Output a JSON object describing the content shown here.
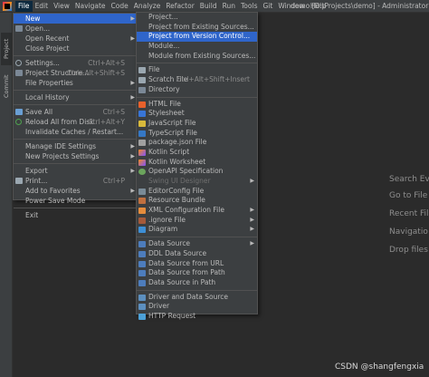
{
  "menubar": {
    "items": [
      "File",
      "Edit",
      "View",
      "Navigate",
      "Code",
      "Analyze",
      "Refactor",
      "Build",
      "Run",
      "Tools",
      "Git",
      "Window",
      "Help"
    ],
    "window_title": "demo [D:\\Projects\\demo] - Administrator"
  },
  "left_strip": {
    "project_tab": "Project",
    "commit_tab": "Commit"
  },
  "file_menu": {
    "items": [
      {
        "label": "New",
        "shortcut": "",
        "has_submenu": true
      },
      {
        "label": "Open...",
        "shortcut": ""
      },
      {
        "label": "Open Recent",
        "shortcut": "",
        "has_submenu": true
      },
      {
        "label": "Close Project",
        "shortcut": ""
      },
      {
        "label": "Settings...",
        "shortcut": "Ctrl+Alt+S"
      },
      {
        "label": "Project Structure...",
        "shortcut": "Ctrl+Alt+Shift+S"
      },
      {
        "label": "File Properties",
        "shortcut": "",
        "has_submenu": true
      },
      {
        "label": "Local History",
        "shortcut": "",
        "has_submenu": true
      },
      {
        "label": "Save All",
        "shortcut": "Ctrl+S"
      },
      {
        "label": "Reload All from Disk",
        "shortcut": "Ctrl+Alt+Y"
      },
      {
        "label": "Invalidate Caches / Restart...",
        "shortcut": ""
      },
      {
        "label": "Manage IDE Settings",
        "shortcut": "",
        "has_submenu": true
      },
      {
        "label": "New Projects Settings",
        "shortcut": "",
        "has_submenu": true
      },
      {
        "label": "Export",
        "shortcut": "",
        "has_submenu": true
      },
      {
        "label": "Print...",
        "shortcut": "Ctrl+P"
      },
      {
        "label": "Add to Favorites",
        "shortcut": "",
        "has_submenu": true
      },
      {
        "label": "Power Save Mode",
        "shortcut": ""
      },
      {
        "label": "Exit",
        "shortcut": ""
      }
    ]
  },
  "new_submenu": {
    "items": [
      {
        "label": "Project...",
        "shortcut": ""
      },
      {
        "label": "Project from Existing Sources...",
        "shortcut": ""
      },
      {
        "label": "Project from Version Control...",
        "shortcut": ""
      },
      {
        "label": "Module...",
        "shortcut": ""
      },
      {
        "label": "Module from Existing Sources...",
        "shortcut": ""
      },
      {
        "label": "File",
        "shortcut": ""
      },
      {
        "label": "Scratch File",
        "shortcut": "Ctrl+Alt+Shift+Insert"
      },
      {
        "label": "Directory",
        "shortcut": ""
      },
      {
        "label": "HTML File",
        "shortcut": ""
      },
      {
        "label": "Stylesheet",
        "shortcut": ""
      },
      {
        "label": "JavaScript File",
        "shortcut": ""
      },
      {
        "label": "TypeScript File",
        "shortcut": ""
      },
      {
        "label": "package.json File",
        "shortcut": ""
      },
      {
        "label": "Kotlin Script",
        "shortcut": ""
      },
      {
        "label": "Kotlin Worksheet",
        "shortcut": ""
      },
      {
        "label": "OpenAPI Specification",
        "shortcut": ""
      },
      {
        "label": "Swing UI Designer",
        "shortcut": ""
      },
      {
        "label": "EditorConfig File",
        "shortcut": ""
      },
      {
        "label": "Resource Bundle",
        "shortcut": ""
      },
      {
        "label": "XML Configuration File",
        "shortcut": ""
      },
      {
        "label": ".ignore File",
        "shortcut": ""
      },
      {
        "label": "Diagram",
        "shortcut": ""
      },
      {
        "label": "Data Source",
        "shortcut": ""
      },
      {
        "label": "DDL Data Source",
        "shortcut": ""
      },
      {
        "label": "Data Source from URL",
        "shortcut": ""
      },
      {
        "label": "Data Source from Path",
        "shortcut": ""
      },
      {
        "label": "Data Source in Path",
        "shortcut": ""
      },
      {
        "label": "Driver and Data Source",
        "shortcut": ""
      },
      {
        "label": "Driver",
        "shortcut": ""
      },
      {
        "label": "HTTP Request",
        "shortcut": ""
      }
    ]
  },
  "welcome_hints": [
    "Search Eve",
    "Go to File",
    "Recent File",
    "Navigatio",
    "Drop files h"
  ],
  "watermark": "CSDN @shangfengxia",
  "colors": {
    "highlight": "#2f65ca",
    "menu_bg": "#3c3f41",
    "editor_bg": "#2b2b2b"
  }
}
